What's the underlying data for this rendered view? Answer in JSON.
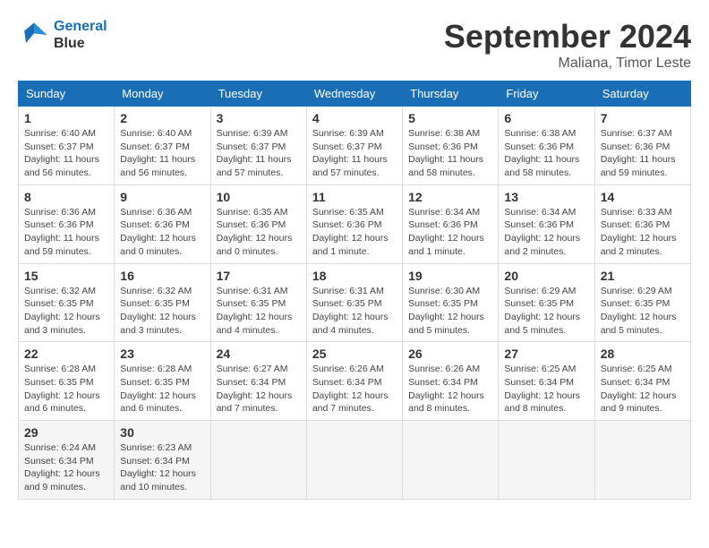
{
  "header": {
    "logo_line1": "General",
    "logo_line2": "Blue",
    "month_title": "September 2024",
    "subtitle": "Maliana, Timor Leste"
  },
  "weekdays": [
    "Sunday",
    "Monday",
    "Tuesday",
    "Wednesday",
    "Thursday",
    "Friday",
    "Saturday"
  ],
  "weeks": [
    [
      {
        "day": "1",
        "info": "Sunrise: 6:40 AM\nSunset: 6:37 PM\nDaylight: 11 hours and 56 minutes."
      },
      {
        "day": "2",
        "info": "Sunrise: 6:40 AM\nSunset: 6:37 PM\nDaylight: 11 hours and 56 minutes."
      },
      {
        "day": "3",
        "info": "Sunrise: 6:39 AM\nSunset: 6:37 PM\nDaylight: 11 hours and 57 minutes."
      },
      {
        "day": "4",
        "info": "Sunrise: 6:39 AM\nSunset: 6:37 PM\nDaylight: 11 hours and 57 minutes."
      },
      {
        "day": "5",
        "info": "Sunrise: 6:38 AM\nSunset: 6:36 PM\nDaylight: 11 hours and 58 minutes."
      },
      {
        "day": "6",
        "info": "Sunrise: 6:38 AM\nSunset: 6:36 PM\nDaylight: 11 hours and 58 minutes."
      },
      {
        "day": "7",
        "info": "Sunrise: 6:37 AM\nSunset: 6:36 PM\nDaylight: 11 hours and 59 minutes."
      }
    ],
    [
      {
        "day": "8",
        "info": "Sunrise: 6:36 AM\nSunset: 6:36 PM\nDaylight: 11 hours and 59 minutes."
      },
      {
        "day": "9",
        "info": "Sunrise: 6:36 AM\nSunset: 6:36 PM\nDaylight: 12 hours and 0 minutes."
      },
      {
        "day": "10",
        "info": "Sunrise: 6:35 AM\nSunset: 6:36 PM\nDaylight: 12 hours and 0 minutes."
      },
      {
        "day": "11",
        "info": "Sunrise: 6:35 AM\nSunset: 6:36 PM\nDaylight: 12 hours and 1 minute."
      },
      {
        "day": "12",
        "info": "Sunrise: 6:34 AM\nSunset: 6:36 PM\nDaylight: 12 hours and 1 minute."
      },
      {
        "day": "13",
        "info": "Sunrise: 6:34 AM\nSunset: 6:36 PM\nDaylight: 12 hours and 2 minutes."
      },
      {
        "day": "14",
        "info": "Sunrise: 6:33 AM\nSunset: 6:36 PM\nDaylight: 12 hours and 2 minutes."
      }
    ],
    [
      {
        "day": "15",
        "info": "Sunrise: 6:32 AM\nSunset: 6:35 PM\nDaylight: 12 hours and 3 minutes."
      },
      {
        "day": "16",
        "info": "Sunrise: 6:32 AM\nSunset: 6:35 PM\nDaylight: 12 hours and 3 minutes."
      },
      {
        "day": "17",
        "info": "Sunrise: 6:31 AM\nSunset: 6:35 PM\nDaylight: 12 hours and 4 minutes."
      },
      {
        "day": "18",
        "info": "Sunrise: 6:31 AM\nSunset: 6:35 PM\nDaylight: 12 hours and 4 minutes."
      },
      {
        "day": "19",
        "info": "Sunrise: 6:30 AM\nSunset: 6:35 PM\nDaylight: 12 hours and 5 minutes."
      },
      {
        "day": "20",
        "info": "Sunrise: 6:29 AM\nSunset: 6:35 PM\nDaylight: 12 hours and 5 minutes."
      },
      {
        "day": "21",
        "info": "Sunrise: 6:29 AM\nSunset: 6:35 PM\nDaylight: 12 hours and 5 minutes."
      }
    ],
    [
      {
        "day": "22",
        "info": "Sunrise: 6:28 AM\nSunset: 6:35 PM\nDaylight: 12 hours and 6 minutes."
      },
      {
        "day": "23",
        "info": "Sunrise: 6:28 AM\nSunset: 6:35 PM\nDaylight: 12 hours and 6 minutes."
      },
      {
        "day": "24",
        "info": "Sunrise: 6:27 AM\nSunset: 6:34 PM\nDaylight: 12 hours and 7 minutes."
      },
      {
        "day": "25",
        "info": "Sunrise: 6:26 AM\nSunset: 6:34 PM\nDaylight: 12 hours and 7 minutes."
      },
      {
        "day": "26",
        "info": "Sunrise: 6:26 AM\nSunset: 6:34 PM\nDaylight: 12 hours and 8 minutes."
      },
      {
        "day": "27",
        "info": "Sunrise: 6:25 AM\nSunset: 6:34 PM\nDaylight: 12 hours and 8 minutes."
      },
      {
        "day": "28",
        "info": "Sunrise: 6:25 AM\nSunset: 6:34 PM\nDaylight: 12 hours and 9 minutes."
      }
    ],
    [
      {
        "day": "29",
        "info": "Sunrise: 6:24 AM\nSunset: 6:34 PM\nDaylight: 12 hours and 9 minutes."
      },
      {
        "day": "30",
        "info": "Sunrise: 6:23 AM\nSunset: 6:34 PM\nDaylight: 12 hours and 10 minutes."
      },
      null,
      null,
      null,
      null,
      null
    ]
  ]
}
